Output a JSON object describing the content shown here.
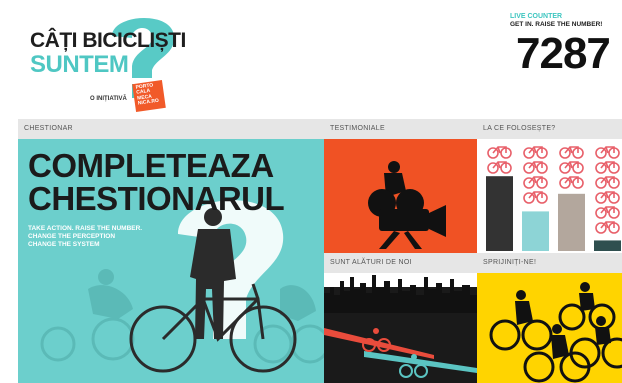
{
  "header": {
    "logo_line1": "CÂȚI BICICLIȘTI",
    "logo_line2": "SUNTEM",
    "logo_initiative": "O INIȚIATIVĂ",
    "logo_badge": [
      "PORTO",
      "CALA",
      "MECA",
      "NICA.RO"
    ]
  },
  "counter": {
    "label": "LIVE COUNTER",
    "subtitle": "GET IN. RAISE THE NUMBER!",
    "value": "7287"
  },
  "sections": {
    "chestionar": "CHESTIONAR",
    "testimoniale": "TESTIMONIALE",
    "la_ce": "LA CE FOLOSEȘTE?",
    "alaturi": "SUNT ALĂTURI DE NOI",
    "sprijin": "SPRIJINIȚI-NE!"
  },
  "main_tile": {
    "title_line1": "COMPLETEAZA",
    "title_line2": "CHESTIONARUL",
    "sub_line1": "TAKE ACTION. RAISE THE NUMBER.",
    "sub_line2": "CHANGE THE PERCEPTION",
    "sub_line3": "CHANGE THE SYSTEM"
  },
  "usage_chart": {
    "bar_levels": [
      0.85,
      0.45,
      0.65,
      0.12
    ],
    "colors": [
      "#333333",
      "#8dd4d6",
      "#b3a79d",
      "#2f4f4f"
    ],
    "bike_color": "#e8606a"
  },
  "colors": {
    "accent_teal": "#4fc7c3",
    "accent_orange": "#f05224",
    "accent_yellow": "#ffd400",
    "dark": "#1a1a1a"
  }
}
